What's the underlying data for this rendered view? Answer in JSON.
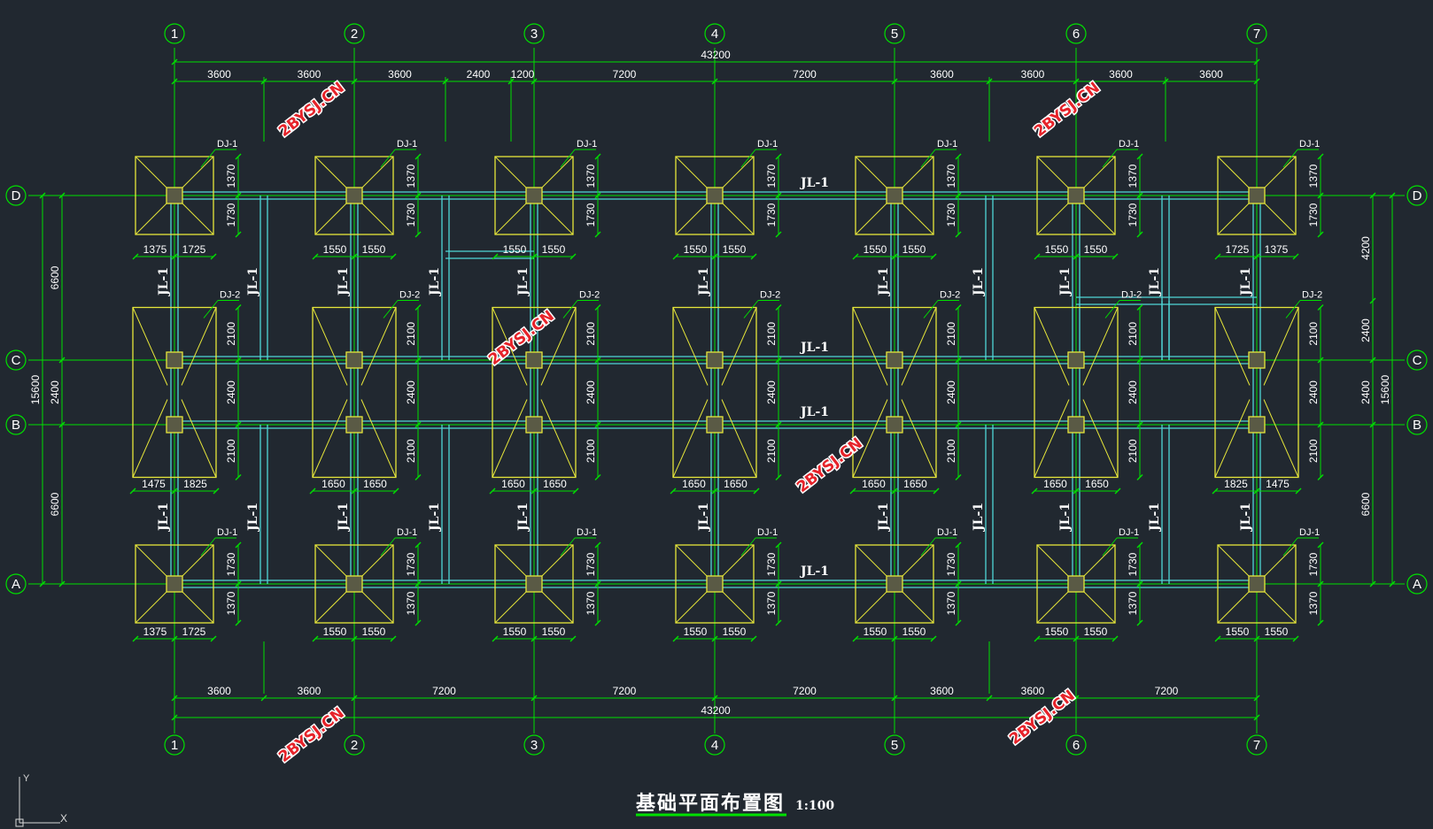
{
  "title": "基础平面布置图",
  "scale": "1:100",
  "watermark": "2BYSJ.CN",
  "colors": {
    "background": "#212830",
    "axis": "#00e000",
    "footing": "#e6e63a",
    "beam": "#4fd6d6",
    "text": "#ffffff",
    "watermark": "#e6232a"
  },
  "grid": {
    "columns": [
      "1",
      "2",
      "3",
      "4",
      "5",
      "6",
      "7"
    ],
    "rows": [
      "D",
      "C",
      "B",
      "A"
    ]
  },
  "dims": {
    "top_total": "43200",
    "top_segments": [
      "3600",
      "3600",
      "3600",
      "2400",
      "1200",
      "7200",
      "7200",
      "3600",
      "3600",
      "3600",
      "3600"
    ],
    "bottom_total": "43200",
    "bottom_segments": [
      "3600",
      "3600",
      "7200",
      "7200",
      "7200",
      "3600",
      "3600",
      "7200"
    ],
    "left_total": "15600",
    "left_segments": [
      "6600",
      "2400",
      "6600"
    ],
    "right_total": "15600",
    "right_segments": [
      "4200",
      "2400",
      "2400",
      "6600"
    ]
  },
  "footing_labels": {
    "row_D": [
      "DJ-1",
      "DJ-1",
      "DJ-1",
      "DJ-1",
      "DJ-1",
      "DJ-1",
      "DJ-1"
    ],
    "row_CB": [
      "DJ-2",
      "DJ-2",
      "DJ-2",
      "DJ-2",
      "DJ-2",
      "DJ-2",
      "DJ-2"
    ],
    "row_A": [
      "DJ-1",
      "DJ-1",
      "DJ-1",
      "DJ-1",
      "DJ-1",
      "DJ-1",
      "DJ-1"
    ]
  },
  "footing_dims": {
    "row_D_width": [
      [
        "1375",
        "1725"
      ],
      [
        "1550",
        "1550"
      ],
      [
        "1550",
        "1550"
      ],
      [
        "1550",
        "1550"
      ],
      [
        "1550",
        "1550"
      ],
      [
        "1550",
        "1550"
      ],
      [
        "1725",
        "1375"
      ]
    ],
    "row_D_height": [
      "1370",
      "1730"
    ],
    "row_CB_width": [
      [
        "1475",
        "1825"
      ],
      [
        "1650",
        "1650"
      ],
      [
        "1650",
        "1650"
      ],
      [
        "1650",
        "1650"
      ],
      [
        "1650",
        "1650"
      ],
      [
        "1650",
        "1650"
      ],
      [
        "1825",
        "1475"
      ]
    ],
    "row_CB_height": [
      "2100",
      "2400",
      "2100"
    ],
    "row_A_width": [
      [
        "1375",
        "1725"
      ],
      [
        "1550",
        "1550"
      ],
      [
        "1550",
        "1550"
      ],
      [
        "1550",
        "1550"
      ],
      [
        "1550",
        "1550"
      ],
      [
        "1550",
        "1550"
      ],
      [
        "1550",
        "1550"
      ]
    ],
    "row_A_height": [
      "1730",
      "1370"
    ]
  },
  "beam_label": "JL-1"
}
